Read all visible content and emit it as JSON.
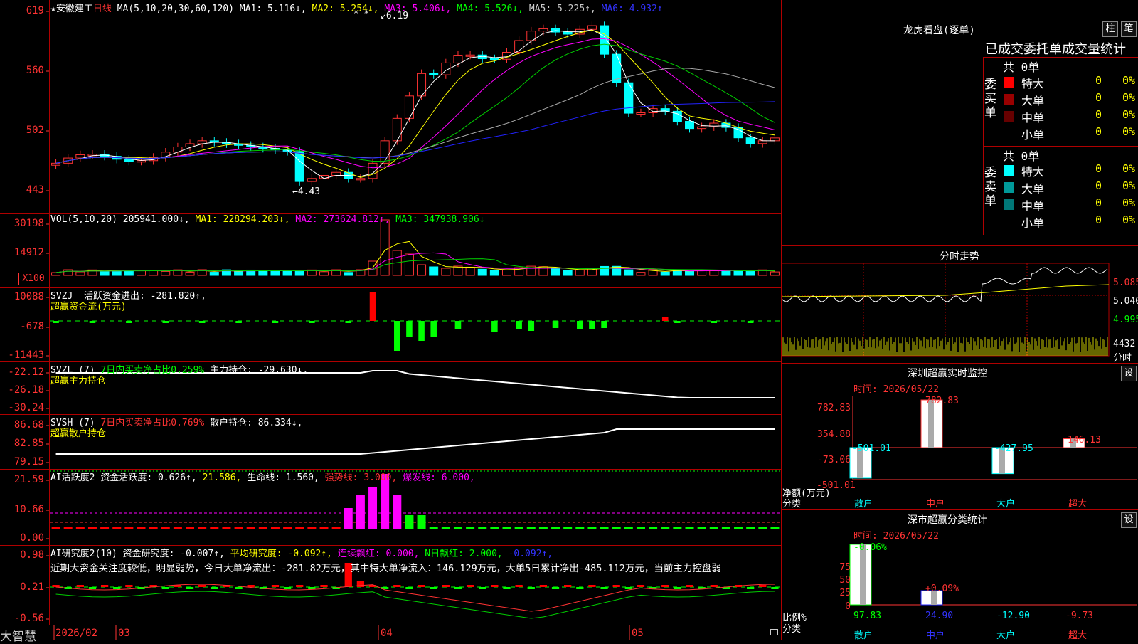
{
  "colors": {
    "up": "#ff3333",
    "down": "#00ffff",
    "frame": "#b00000",
    "ma1": "#ffffff",
    "ma2": "#ffff00",
    "ma3": "#ff00ff",
    "ma4": "#00cc00",
    "ma5": "#aaaaaa",
    "ma6": "#2222ff"
  },
  "main": {
    "star": "★",
    "stock": "安徽建工",
    "period": "日线",
    "ma_label": "MA(5,10,20,30,60,120)",
    "ma1": "MA1: 5.116↓,",
    "ma2": "MA2: 5.254↓,",
    "ma3": "MA3: 5.406↓,",
    "ma4": "MA4: 5.526↓,",
    "ma5": "MA5: 5.225↑,",
    "ma6": "MA6: 4.932↑",
    "high_mark": "6.19",
    "low_mark": "4.43",
    "marks": "* *",
    "y_ticks": [
      "619",
      "560",
      "502",
      "443"
    ]
  },
  "vol": {
    "label": "VOL(5,10,20)",
    "v": "205941.000↓,",
    "ma1": "MA1: 228294.203↓,",
    "ma2": "MA2: 273624.812↑,",
    "ma3": "MA3: 347938.906↓",
    "y_ticks": [
      "30198",
      "14912"
    ],
    "unit": "X100"
  },
  "svzj": {
    "label": "SVZJ",
    "t1": "活跃资金进出: -281.820↑,",
    "t2": "超赢资金流(万元)",
    "y_ticks": [
      "10088",
      "-678",
      "-11443"
    ]
  },
  "svzl": {
    "label": "SVZL (7)",
    "t1": "7日内买卖净占比0.259%",
    "t2": "主力持仓: -29.630↓,",
    "t3": "超赢主力持仓",
    "y_ticks": [
      "-22.12",
      "-26.18",
      "-30.24"
    ]
  },
  "svsh": {
    "label": "SVSH (7)",
    "t1": "7日内买卖净占比0.769%",
    "t2": "散户持仓: 86.334↓,",
    "t3": "超赢散户持仓",
    "y_ticks": [
      "86.68",
      "82.85",
      "79.15"
    ]
  },
  "ai2": {
    "label": "AI活跃度2",
    "t1": "资金活跃度: 0.626↑,",
    "t2": "21.586,",
    "t3": "生命线: 1.560,",
    "t4": "强势线: 3.000,",
    "t5": "爆发线: 6.000,",
    "y_ticks": [
      "21.59",
      "10.66",
      "0.00"
    ]
  },
  "ai_res": {
    "label": "AI研究度2(10)",
    "t1": "资金研究度: -0.007↑,",
    "t2": "平均研究度: -0.092↑,",
    "t3": "连续飘红: 0.000,",
    "t4": "N日飘红: 2.000,",
    "t5": "-0.092↑,",
    "comment": "近期大资金关注度较低，明显弱势，今日大单净流出：-281.82万元，其中特大单净流入：146.129万元，大单5日累计净出-485.112万元，当前主力控盘弱",
    "y_ticks": [
      "0.98",
      "0.21",
      "-0.56"
    ]
  },
  "bottom": {
    "brand": "大智慧",
    "date": "2026/02",
    "m1": "03",
    "m2": "04",
    "m3": "05"
  },
  "longhu": {
    "title": "龙虎看盘(逐单)",
    "btn1": "柱",
    "btn2": "笔",
    "sub": "已成交委托单成交量统计",
    "buy": {
      "side": "委买单",
      "total": "共 0单",
      "rows": [
        {
          "name": "特大",
          "v": "0",
          "p": "0%",
          "c": "#ff0000"
        },
        {
          "name": "大单",
          "v": "0",
          "p": "0%",
          "c": "#990000"
        },
        {
          "name": "中单",
          "v": "0",
          "p": "0%",
          "c": "#660000"
        },
        {
          "name": "小单",
          "v": "0",
          "p": "0%",
          "c": ""
        }
      ]
    },
    "sell": {
      "side": "委卖单",
      "total": "共 0单",
      "rows": [
        {
          "name": "特大",
          "v": "0",
          "p": "0%",
          "c": "#00ffff"
        },
        {
          "name": "大单",
          "v": "0",
          "p": "0%",
          "c": "#009999"
        },
        {
          "name": "中单",
          "v": "0",
          "p": "0%",
          "c": "#007777"
        },
        {
          "name": "小单",
          "v": "0",
          "p": "0%",
          "c": ""
        }
      ]
    }
  },
  "fenshi": {
    "title": "分时走势",
    "p1": "5.085",
    "p2": "5.040",
    "p3": "4.995",
    "vol": "4432",
    "foot": "分时"
  },
  "sz_monitor": {
    "title": "深圳超赢实时监控",
    "btn": "设",
    "time": "时间: 2026/05/22",
    "y_ticks": [
      "782.83",
      "354.88",
      "-73.06",
      "-501.01"
    ],
    "ylabel": "净额(万元)",
    "xlabel": "分类",
    "cats": [
      "散户",
      "中户",
      "大户",
      "超大"
    ],
    "vals": [
      "-501.01",
      "782.83",
      "-427.95",
      "146.13"
    ]
  },
  "sz_class": {
    "title": "深市超赢分类统计",
    "btn": "设",
    "time": "时间: 2026/05/22",
    "y_ticks": [
      "75",
      "50",
      "25",
      "0"
    ],
    "ylabel": "比例%",
    "xlabel": "分类",
    "top_labels": [
      "-0.06%",
      "+0.09%"
    ],
    "cats": [
      "散户",
      "中户",
      "大户",
      "超大"
    ],
    "vals": [
      "97.83",
      "24.90",
      "-12.90",
      "-9.73"
    ]
  }
}
